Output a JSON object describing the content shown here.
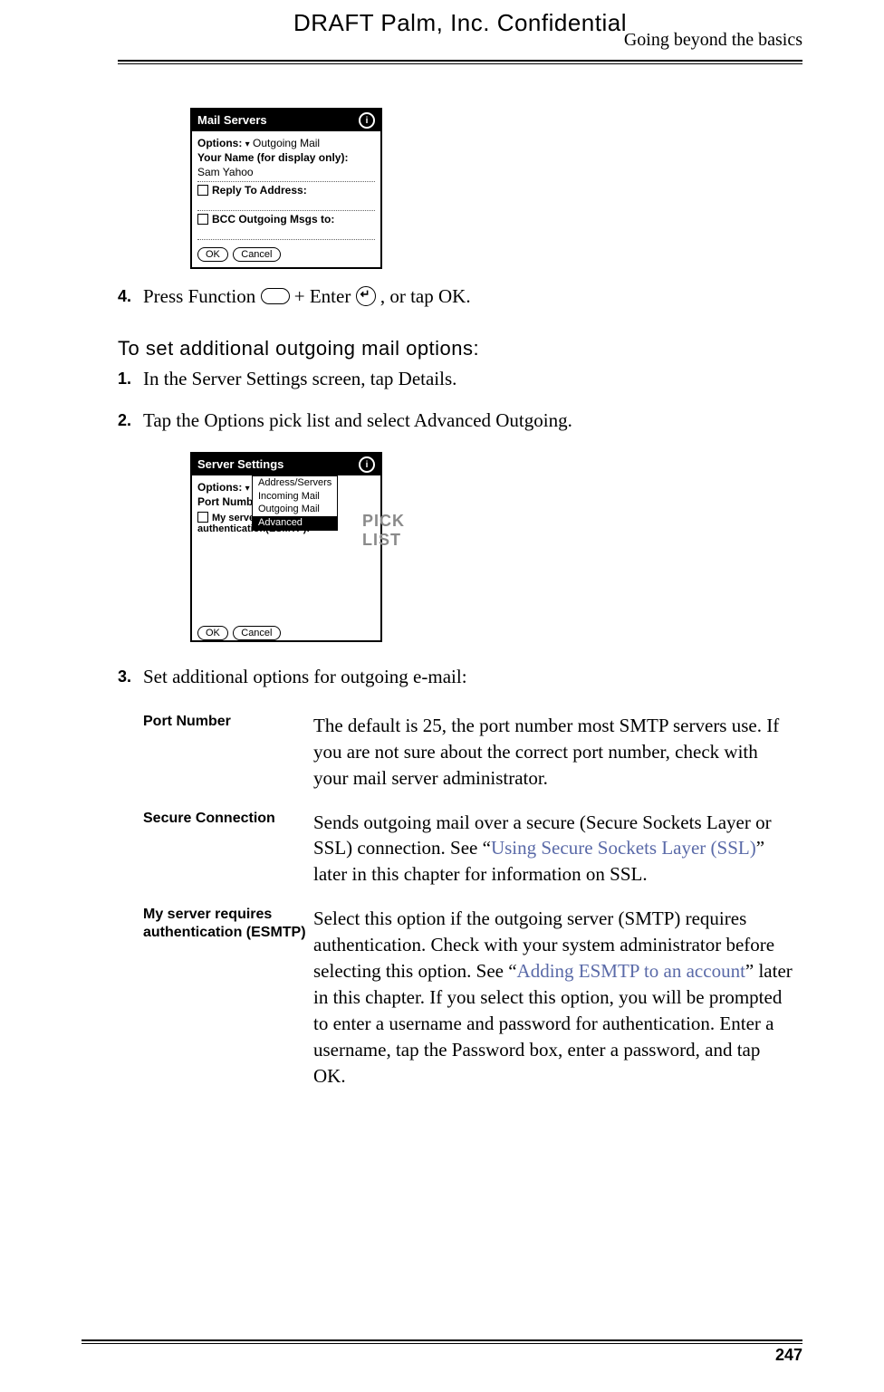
{
  "header": {
    "draft": "DRAFT   Palm, Inc. Confidential",
    "section": "Going beyond the basics"
  },
  "device1": {
    "title": "Mail Servers",
    "options_label": "Options:",
    "options_value": "Outgoing Mail",
    "yourname_label": "Your Name (for display only):",
    "yourname_value": "Sam Yahoo",
    "reply_label": "Reply To Address:",
    "bcc_label": "BCC Outgoing Msgs to:",
    "ok": "OK",
    "cancel": "Cancel"
  },
  "step4": {
    "num": "4.",
    "pre": "Press Function ",
    "mid": " + Enter ",
    "post": ", or tap OK."
  },
  "subhead": "To set additional outgoing mail options:",
  "step1": {
    "num": "1.",
    "txt": "In the Server Settings screen, tap Details."
  },
  "step2": {
    "num": "2.",
    "txt": "Tap the Options pick list and select Advanced Outgoing."
  },
  "device2": {
    "title": "Server Settings",
    "options_label": "Options:",
    "port_label": "Port Numb",
    "auth_label": "My server requires authentication(ESMTP):",
    "pick": {
      "a": "Address/Servers",
      "b": "Incoming Mail",
      "c": "Outgoing Mail",
      "d": "Advanced"
    },
    "ok": "OK",
    "cancel": "Cancel"
  },
  "picklabel": "PICK LIST",
  "step3": {
    "num": "3.",
    "txt": "Set additional options for outgoing e-mail:"
  },
  "defs": {
    "r1": {
      "term": "Port Number",
      "desc": "The default is 25, the port number most SMTP servers use. If you are not sure about the correct port number, check with your mail server administrator."
    },
    "r2": {
      "term": "Secure Connection",
      "desc_a": "Sends outgoing mail over a secure (Secure Sockets Layer or SSL) connection. See “",
      "link": "Using Secure Sockets Layer (SSL)",
      "desc_b": "” later in this chapter for information on SSL."
    },
    "r3": {
      "term": "My server requires authentication (ESMTP)",
      "desc_a": "Select this option if the outgoing server (SMTP) requires authentication. Check with your system administrator before selecting this option. See “",
      "link": "Adding ESMTP to an account",
      "desc_b": "” later in this chapter. If you select this option, you will be prompted to enter a username and password for authentication. Enter a username, tap the Password box, enter a password, and tap OK."
    }
  },
  "page_number": "247"
}
